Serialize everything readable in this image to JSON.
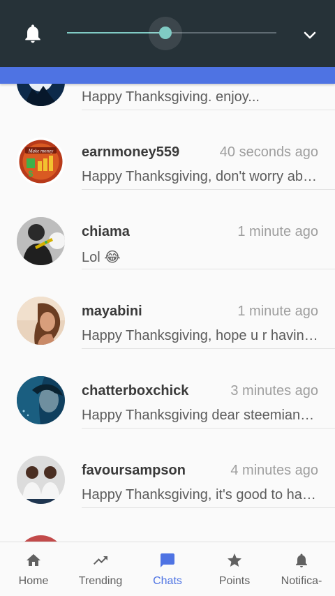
{
  "colors": {
    "topbar_bg": "#263238",
    "slider_accent": "#80cbc4",
    "header_blue": "#4e73e3",
    "active_nav": "#4e73e3",
    "inactive_nav": "#616161"
  },
  "volume": {
    "icon": "bell-icon",
    "level_percent": 47,
    "expand_icon": "chevron-down-icon"
  },
  "chats": [
    {
      "name": "",
      "time": "",
      "preview": "Happy Thanksgiving. enjoy...",
      "avatar": "wolf-moon-avatar"
    },
    {
      "name": "earnmoney559",
      "time": "40 seconds ago",
      "preview": "Happy Thanksgiving, don't worry about...",
      "avatar": "make-money-avatar"
    },
    {
      "name": "chiama",
      "time": "1 minute ago",
      "preview": "Lol 😂",
      "avatar": "person-avatar"
    },
    {
      "name": "mayabini",
      "time": "1 minute ago",
      "preview": "Happy Thanksgiving, hope u r having...",
      "avatar": "person-avatar"
    },
    {
      "name": "chatterboxchick",
      "time": "3 minutes ago",
      "preview": "Happy Thanksgiving dear steemians...",
      "avatar": "person-avatar"
    },
    {
      "name": "favoursampson",
      "time": "4 minutes ago",
      "preview": "Happy Thanksgiving, it's good to have...",
      "avatar": "two-people-avatar"
    },
    {
      "name": "",
      "time": "",
      "preview": "",
      "avatar": "person-avatar"
    }
  ],
  "bottom_nav": [
    {
      "label": "Home",
      "icon": "home-icon",
      "active": false
    },
    {
      "label": "Trending",
      "icon": "trending-up-icon",
      "active": false
    },
    {
      "label": "Chats",
      "icon": "chat-icon",
      "active": true
    },
    {
      "label": "Points",
      "icon": "star-icon",
      "active": false
    },
    {
      "label": "Notifica-",
      "icon": "bell-icon",
      "active": false
    }
  ]
}
